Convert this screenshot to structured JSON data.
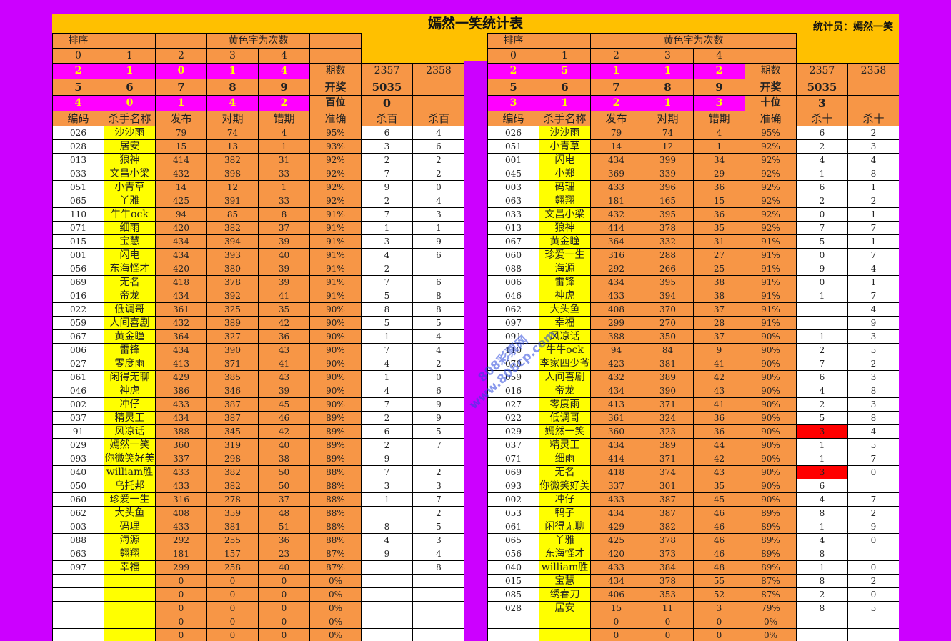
{
  "title": "嫣然一笑统计表",
  "statistician": "统计员：嫣然一笑",
  "colors": {
    "frame": "#cc00ff",
    "header": "#ffc000",
    "orange": "#f79646",
    "yellow": "#ffff00",
    "pink": "#ff00ff",
    "red": "#ff0000"
  },
  "watermark": [
    "808彩票网",
    "www.808cp.com"
  ],
  "left": {
    "sort_label": "排序",
    "yellow_label": "黄色字为次数",
    "digits_row1": [
      "0",
      "1",
      "2",
      "3",
      "4"
    ],
    "counts_row1": [
      "2",
      "1",
      "0",
      "1",
      "4"
    ],
    "issue_label": "期数",
    "issues": [
      "2357",
      "2358"
    ],
    "digits_row2": [
      "5",
      "6",
      "7",
      "8",
      "9"
    ],
    "draw_label": "开奖",
    "draw_value": "5035",
    "counts_row2": [
      "4",
      "0",
      "1",
      "4",
      "2"
    ],
    "position_label": "百位",
    "position_value": "0",
    "columns": [
      "编码",
      "杀手名称",
      "发布",
      "对期",
      "错期",
      "准确",
      "杀百",
      "杀百"
    ],
    "rows": [
      [
        "026",
        "沙沙雨",
        "79",
        "74",
        "4",
        "95%",
        "6",
        "4"
      ],
      [
        "028",
        "居安",
        "15",
        "13",
        "1",
        "93%",
        "3",
        "6"
      ],
      [
        "013",
        "狼神",
        "414",
        "382",
        "31",
        "92%",
        "2",
        "2"
      ],
      [
        "033",
        "文昌小梁",
        "432",
        "398",
        "33",
        "92%",
        "7",
        "2"
      ],
      [
        "051",
        "小青草",
        "14",
        "12",
        "1",
        "92%",
        "9",
        "0"
      ],
      [
        "065",
        "丫雅",
        "425",
        "391",
        "33",
        "92%",
        "2",
        "4"
      ],
      [
        "110",
        "牛牛ock",
        "94",
        "85",
        "8",
        "91%",
        "7",
        "3"
      ],
      [
        "071",
        "细雨",
        "420",
        "382",
        "37",
        "91%",
        "1",
        "1"
      ],
      [
        "015",
        "宝慧",
        "434",
        "394",
        "39",
        "91%",
        "3",
        "9"
      ],
      [
        "001",
        "闪电",
        "434",
        "393",
        "40",
        "91%",
        "4",
        "6"
      ],
      [
        "056",
        "东海怪才",
        "420",
        "380",
        "39",
        "91%",
        "2",
        ""
      ],
      [
        "069",
        "无名",
        "418",
        "378",
        "39",
        "91%",
        "7",
        "6"
      ],
      [
        "016",
        "帝龙",
        "434",
        "392",
        "41",
        "91%",
        "5",
        "8"
      ],
      [
        "022",
        "低调哥",
        "361",
        "325",
        "35",
        "90%",
        "8",
        "8"
      ],
      [
        "059",
        "人间喜剧",
        "432",
        "389",
        "42",
        "90%",
        "5",
        "5"
      ],
      [
        "067",
        "黄金瞳",
        "364",
        "327",
        "36",
        "90%",
        "1",
        "4"
      ],
      [
        "006",
        "雷锋",
        "434",
        "390",
        "43",
        "90%",
        "7",
        "4"
      ],
      [
        "027",
        "零度雨",
        "413",
        "371",
        "41",
        "90%",
        "4",
        "2"
      ],
      [
        "061",
        "闲得无聊",
        "429",
        "385",
        "43",
        "90%",
        "1",
        "0"
      ],
      [
        "046",
        "神虎",
        "386",
        "346",
        "39",
        "90%",
        "4",
        "6"
      ],
      [
        "002",
        "冲仔",
        "433",
        "387",
        "45",
        "90%",
        "7",
        "9"
      ],
      [
        "037",
        "精灵王",
        "434",
        "387",
        "46",
        "89%",
        "2",
        "9"
      ],
      [
        "91",
        "风凉话",
        "388",
        "345",
        "42",
        "89%",
        "6",
        "5"
      ],
      [
        "029",
        "嫣然一笑",
        "360",
        "319",
        "40",
        "89%",
        "2",
        "7"
      ],
      [
        "093",
        "你微笑好美",
        "337",
        "298",
        "38",
        "89%",
        "9",
        ""
      ],
      [
        "040",
        "william胜",
        "433",
        "382",
        "50",
        "88%",
        "7",
        "2"
      ],
      [
        "050",
        "乌托邦",
        "433",
        "382",
        "50",
        "88%",
        "3",
        "3"
      ],
      [
        "060",
        "珍爱一生",
        "316",
        "278",
        "37",
        "88%",
        "1",
        "7"
      ],
      [
        "062",
        "大头鱼",
        "408",
        "359",
        "48",
        "88%",
        "",
        "2"
      ],
      [
        "003",
        "码理",
        "433",
        "381",
        "51",
        "88%",
        "8",
        "5"
      ],
      [
        "088",
        "海源",
        "292",
        "255",
        "36",
        "88%",
        "4",
        "3"
      ],
      [
        "063",
        "翱翔",
        "181",
        "157",
        "23",
        "87%",
        "9",
        "4"
      ],
      [
        "097",
        "幸福",
        "299",
        "258",
        "40",
        "87%",
        "",
        "8"
      ],
      [
        "",
        "",
        "0",
        "0",
        "0",
        "0%",
        "",
        ""
      ],
      [
        "",
        "",
        "0",
        "0",
        "0",
        "0%",
        "",
        ""
      ],
      [
        "",
        "",
        "0",
        "0",
        "0",
        "0%",
        "",
        ""
      ],
      [
        "",
        "",
        "0",
        "0",
        "0",
        "0%",
        "",
        ""
      ],
      [
        "",
        "",
        "0",
        "0",
        "0",
        "0%",
        "",
        ""
      ]
    ]
  },
  "right": {
    "sort_label": "排序",
    "yellow_label": "黄色字为次数",
    "digits_row1": [
      "0",
      "1",
      "2",
      "3",
      "4"
    ],
    "counts_row1": [
      "2",
      "5",
      "1",
      "1",
      "2"
    ],
    "issue_label": "期数",
    "issues": [
      "2357",
      "2358"
    ],
    "digits_row2": [
      "5",
      "6",
      "7",
      "8",
      "9"
    ],
    "draw_label": "开奖",
    "draw_value": "5035",
    "counts_row2": [
      "3",
      "1",
      "2",
      "1",
      "3"
    ],
    "position_label": "十位",
    "position_value": "3",
    "columns": [
      "编码",
      "杀手名称",
      "发布",
      "对期",
      "错期",
      "准确",
      "杀十",
      "杀十"
    ],
    "rows": [
      [
        "026",
        "沙沙雨",
        "79",
        "74",
        "4",
        "95%",
        "6",
        "2"
      ],
      [
        "051",
        "小青草",
        "14",
        "12",
        "1",
        "92%",
        "2",
        "3"
      ],
      [
        "001",
        "闪电",
        "434",
        "399",
        "34",
        "92%",
        "4",
        "4"
      ],
      [
        "045",
        "小郑",
        "369",
        "339",
        "29",
        "92%",
        "1",
        "8"
      ],
      [
        "003",
        "码理",
        "433",
        "396",
        "36",
        "92%",
        "6",
        "1"
      ],
      [
        "063",
        "翱翔",
        "181",
        "165",
        "15",
        "92%",
        "2",
        "2"
      ],
      [
        "033",
        "文昌小梁",
        "432",
        "395",
        "36",
        "92%",
        "0",
        "1"
      ],
      [
        "013",
        "狼神",
        "414",
        "378",
        "35",
        "92%",
        "7",
        "7"
      ],
      [
        "067",
        "黄金瞳",
        "364",
        "332",
        "31",
        "91%",
        "5",
        "1"
      ],
      [
        "060",
        "珍爱一生",
        "316",
        "288",
        "27",
        "91%",
        "0",
        "7"
      ],
      [
        "088",
        "海源",
        "292",
        "266",
        "25",
        "91%",
        "9",
        "4"
      ],
      [
        "006",
        "雷锋",
        "434",
        "395",
        "38",
        "91%",
        "0",
        "1"
      ],
      [
        "046",
        "神虎",
        "433",
        "394",
        "38",
        "91%",
        "1",
        "7"
      ],
      [
        "062",
        "大头鱼",
        "408",
        "370",
        "37",
        "91%",
        "",
        "4"
      ],
      [
        "097",
        "幸福",
        "299",
        "270",
        "28",
        "91%",
        "",
        "9"
      ],
      [
        "091",
        "风凉话",
        "388",
        "350",
        "37",
        "90%",
        "1",
        "3"
      ],
      [
        "110",
        "牛牛ock",
        "94",
        "84",
        "9",
        "90%",
        "2",
        "5"
      ],
      [
        "070",
        "李家四少爷",
        "423",
        "381",
        "41",
        "90%",
        "7",
        "2"
      ],
      [
        "059",
        "人间喜剧",
        "432",
        "389",
        "42",
        "90%",
        "6",
        "3"
      ],
      [
        "016",
        "帝龙",
        "434",
        "390",
        "43",
        "90%",
        "4",
        "8"
      ],
      [
        "027",
        "零度雨",
        "413",
        "371",
        "41",
        "90%",
        "2",
        "3"
      ],
      [
        "022",
        "低调哥",
        "361",
        "324",
        "36",
        "90%",
        "5",
        "8"
      ],
      [
        "029",
        "嫣然一笑",
        "360",
        "323",
        "36",
        "90%",
        "3",
        "4"
      ],
      [
        "037",
        "精灵王",
        "434",
        "389",
        "44",
        "90%",
        "1",
        "5"
      ],
      [
        "071",
        "细雨",
        "414",
        "371",
        "42",
        "90%",
        "1",
        "7"
      ],
      [
        "069",
        "无名",
        "418",
        "374",
        "43",
        "90%",
        "3",
        "0"
      ],
      [
        "093",
        "你微笑好美",
        "337",
        "301",
        "35",
        "90%",
        "6",
        ""
      ],
      [
        "002",
        "冲仔",
        "433",
        "387",
        "45",
        "90%",
        "4",
        "7"
      ],
      [
        "053",
        "鸭子",
        "434",
        "387",
        "46",
        "89%",
        "8",
        "2"
      ],
      [
        "061",
        "闲得无聊",
        "429",
        "382",
        "46",
        "89%",
        "1",
        "9"
      ],
      [
        "065",
        "丫雅",
        "425",
        "378",
        "46",
        "89%",
        "4",
        "0"
      ],
      [
        "056",
        "东海怪才",
        "420",
        "373",
        "46",
        "89%",
        "8",
        ""
      ],
      [
        "040",
        "william胜",
        "433",
        "384",
        "48",
        "89%",
        "1",
        "0"
      ],
      [
        "015",
        "宝慧",
        "434",
        "378",
        "55",
        "87%",
        "8",
        "2"
      ],
      [
        "085",
        "绣春刀",
        "406",
        "353",
        "52",
        "87%",
        "2",
        "0"
      ],
      [
        "028",
        "居安",
        "15",
        "11",
        "3",
        "79%",
        "8",
        "5"
      ],
      [
        "",
        "",
        "0",
        "0",
        "0",
        "0%",
        "",
        ""
      ],
      [
        "",
        "",
        "0",
        "0",
        "0",
        "0%",
        "",
        ""
      ]
    ],
    "highlight_rows": [
      22,
      25
    ]
  }
}
